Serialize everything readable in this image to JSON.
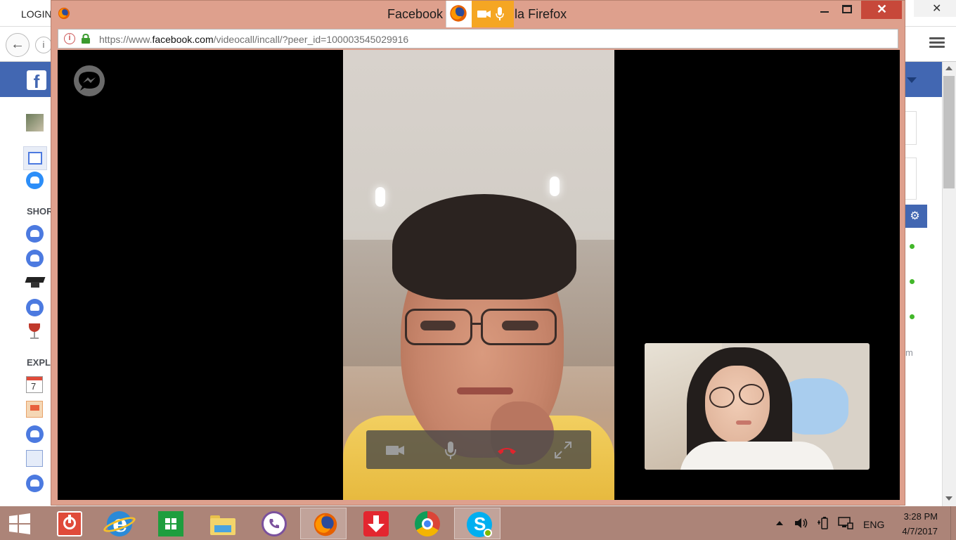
{
  "background_window": {
    "tab_label": "LOGIN",
    "info_icon_label": "i",
    "facebook_logo": "f",
    "sidebar_sections": [
      "SHOR",
      "EXPL"
    ],
    "calendar_day": "7",
    "right_panel_fragment": "m"
  },
  "popup": {
    "title": "Facebook - Mozilla Firefox",
    "title_left": "Facebook",
    "title_right": "lla Firefox",
    "url_scheme": "https://www.",
    "url_domain": "facebook.com",
    "url_path": "/videocall/incall/?peer_id=100003545029916",
    "close_glyph": "✕"
  },
  "call": {
    "messenger_icon": "messenger-icon",
    "controls": [
      "camera-icon",
      "microphone-icon",
      "end-call-icon",
      "fullscreen-icon"
    ],
    "end_call_color": "#e0242d"
  },
  "taskbar": {
    "apps": [
      "power-app",
      "internet-explorer",
      "store",
      "file-explorer",
      "viber",
      "firefox",
      "downloader",
      "chrome",
      "skype"
    ],
    "active_app": "firefox",
    "language": "ENG",
    "time": "3:28 PM",
    "date": "4/7/2017"
  },
  "colors": {
    "popup_frame": "#dea08d",
    "facebook_blue": "#4267b2",
    "taskbar": "#ac8478",
    "close_button": "#c7483a",
    "sharing_indicator": "#f5a623"
  }
}
